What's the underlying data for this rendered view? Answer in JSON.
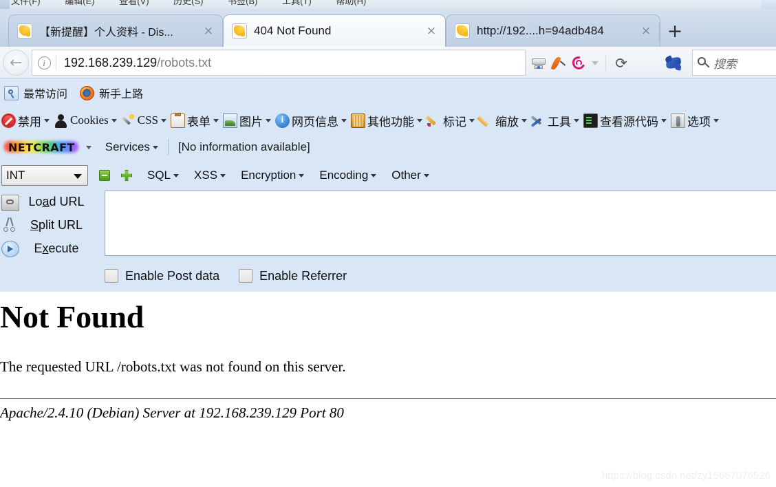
{
  "window_menu": {
    "items": [
      "文件(F)",
      "编辑(E)",
      "查看(V)",
      "历史(S)",
      "书签(B)",
      "工具(T)",
      "帮助(H)"
    ]
  },
  "tabs": [
    {
      "title": "【新提醒】个人资料 - Dis...",
      "close_label": "×",
      "active": false
    },
    {
      "title": "404 Not Found",
      "close_label": "×",
      "active": true
    },
    {
      "title": "http://192....h=94adb484",
      "close_label": "×",
      "active": false
    }
  ],
  "new_tab_label": "+",
  "navbar": {
    "back_label": "←",
    "identity_label": "i",
    "url_host": "192.168.239.129",
    "url_path": "/robots.txt",
    "icons": [
      "server-icon",
      "apache-feather-icon",
      "debian-swirl-icon"
    ],
    "dropdown_label": "▼",
    "reload_label": "⟳",
    "bird_icon": "blue-bird-icon",
    "search_placeholder": "搜索"
  },
  "bookmarks": [
    {
      "label": "最常访问",
      "icon": "most-visited-folder-icon"
    },
    {
      "label": "新手上路",
      "icon": "firefox-getting-started-icon"
    }
  ],
  "webdev_toolbar": {
    "items": [
      {
        "label": "禁用",
        "icon": "disable-icon",
        "caret": true
      },
      {
        "label": "Cookies",
        "icon": "cookies-person-icon",
        "caret": true
      },
      {
        "label": "CSS",
        "icon": "css-wand-icon",
        "caret": true
      },
      {
        "label": "表单",
        "icon": "forms-clipboard-icon",
        "caret": true
      },
      {
        "label": "图片",
        "icon": "images-picture-icon",
        "caret": true
      },
      {
        "label": "网页信息",
        "icon": "page-info-icon",
        "caret": true
      },
      {
        "label": "其他功能",
        "icon": "misc-book-icon",
        "caret": true
      },
      {
        "label": "标记",
        "icon": "outline-pencil-icon",
        "caret": true
      },
      {
        "label": "缩放",
        "icon": "resize-ruler-icon",
        "caret": true
      },
      {
        "label": "工具",
        "icon": "tools-icon",
        "caret": true
      },
      {
        "label": "查看源代码",
        "icon": "view-source-icon",
        "caret": true
      },
      {
        "label": "选项",
        "icon": "options-icon",
        "caret": true
      }
    ]
  },
  "netcraft_toolbar": {
    "logo_text": "NETCRAFT",
    "services_label": "Services",
    "info_text": "[No information available]"
  },
  "hackbar": {
    "type_select_value": "INT",
    "collapse_label": "−",
    "expand_label": "+",
    "menus": [
      "SQL",
      "XSS",
      "Encryption",
      "Encoding",
      "Other"
    ],
    "actions": [
      {
        "label_before": "Lo",
        "accel": "a",
        "label_after": "d URL",
        "icon": "load-url-icon"
      },
      {
        "label_before": "",
        "accel": "S",
        "label_after": "plit URL",
        "icon": "split-url-icon"
      },
      {
        "label_before": "E",
        "accel": "x",
        "label_after": "ecute",
        "icon": "execute-icon"
      }
    ],
    "url_value": "",
    "checkboxes": [
      {
        "label": "Enable Post data",
        "checked": false
      },
      {
        "label": "Enable Referrer",
        "checked": false
      }
    ]
  },
  "page": {
    "heading": "Not Found",
    "message": "The requested URL /robots.txt was not found on this server.",
    "server_signature": "Apache/2.4.10 (Debian) Server at 192.168.239.129 Port 80"
  },
  "watermark": "https://blog.csdn.net/zy15667076526"
}
